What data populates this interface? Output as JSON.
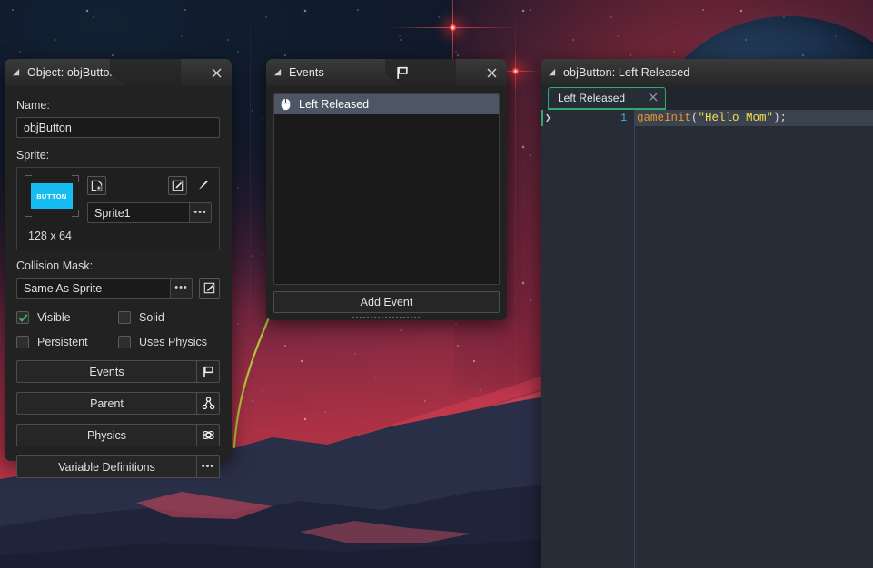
{
  "background": {
    "description": "space-landscape-wallpaper",
    "sky_top_color": "#0e1726",
    "sky_bottom_color": "#b23a4c",
    "planet_color": "#1d3350",
    "flare_color": "#ff5a50",
    "mountain_color": "#262a42",
    "accent_line_color": "#b4d13a"
  },
  "object_panel": {
    "title": "Object: objButton",
    "caret_icon": "collapse-caret-icon",
    "close_icon": "close-icon",
    "name_label": "Name:",
    "name_value": "objButton",
    "sprite_label": "Sprite:",
    "sprite_thumb_text": "BUTTON",
    "sprite_thumb_color": "#16bdf0",
    "sprite_new_icon": "new-sprite-icon",
    "sprite_edit_image_icon": "edit-image-icon",
    "sprite_paint_icon": "paint-brush-icon",
    "sprite_name": "Sprite1",
    "sprite_ellipsis": "•••",
    "sprite_size": "128 x 64",
    "collision_label": "Collision Mask:",
    "collision_value": "Same As Sprite",
    "collision_ellipsis": "•••",
    "collision_edit_icon": "edit-mask-icon",
    "checkboxes": [
      {
        "label": "Visible",
        "checked": true
      },
      {
        "label": "Solid",
        "checked": false
      },
      {
        "label": "Persistent",
        "checked": false
      },
      {
        "label": "Uses Physics",
        "checked": false
      }
    ],
    "check_color": "#3ab56a",
    "actions": [
      {
        "label": "Events",
        "icon": "flag-icon"
      },
      {
        "label": "Parent",
        "icon": "parent-hierarchy-icon"
      },
      {
        "label": "Physics",
        "icon": "physics-gear-icon"
      },
      {
        "label": "Variable Definitions",
        "icon": "ellipsis-icon"
      }
    ]
  },
  "events_panel": {
    "title": "Events",
    "caret_icon": "collapse-caret-icon",
    "flag_icon": "flag-icon",
    "close_icon": "close-icon",
    "items": [
      {
        "label": "Left Released",
        "icon": "mouse-icon",
        "selected": true
      }
    ],
    "selected_color": "#4c5664",
    "add_event_label": "Add Event"
  },
  "code_panel": {
    "title": "objButton: Left Released",
    "caret_icon": "collapse-caret-icon",
    "tab_label": "Left Released",
    "tab_close_icon": "close-icon",
    "tab_accent_color": "#2faa6a",
    "gutter_caret": "❯",
    "line_number": "1",
    "code_tokens": [
      {
        "text": "gameInit",
        "type": "function",
        "color": "#e8952f"
      },
      {
        "text": "(",
        "type": "punct",
        "color": "#d8d8d8"
      },
      {
        "text": "\"Hello Mom\"",
        "type": "string",
        "color": "#f2e14c"
      },
      {
        "text": ");",
        "type": "punct",
        "color": "#d8d8d8"
      }
    ],
    "code_text": "gameInit(\"Hello Mom\");"
  }
}
